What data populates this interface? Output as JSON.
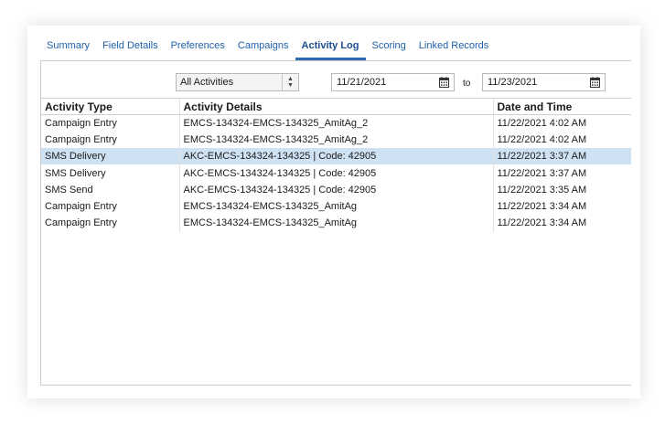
{
  "tabs": [
    {
      "label": "Summary",
      "active": false
    },
    {
      "label": "Field Details",
      "active": false
    },
    {
      "label": "Preferences",
      "active": false
    },
    {
      "label": "Campaigns",
      "active": false
    },
    {
      "label": "Activity Log",
      "active": true
    },
    {
      "label": "Scoring",
      "active": false
    },
    {
      "label": "Linked Records",
      "active": false
    }
  ],
  "filter": {
    "activity_type_selected": "All Activities",
    "date_from": "11/21/2021",
    "date_to": "11/23/2021",
    "to_label": "to"
  },
  "table": {
    "columns": [
      "Activity Type",
      "Activity Details",
      "Date and Time"
    ],
    "rows": [
      {
        "type": "Campaign Entry",
        "details": "EMCS-134324-EMCS-134325_AmitAg_2",
        "datetime": "11/22/2021 4:02 AM",
        "selected": false
      },
      {
        "type": "Campaign Entry",
        "details": "EMCS-134324-EMCS-134325_AmitAg_2",
        "datetime": "11/22/2021 4:02 AM",
        "selected": false
      },
      {
        "type": "SMS Delivery",
        "details": "AKC-EMCS-134324-134325 | Code: 42905",
        "datetime": "11/22/2021 3:37 AM",
        "selected": true
      },
      {
        "type": "SMS Delivery",
        "details": "AKC-EMCS-134324-134325 | Code: 42905",
        "datetime": "11/22/2021 3:37 AM",
        "selected": false
      },
      {
        "type": "SMS Send",
        "details": "AKC-EMCS-134324-134325 | Code: 42905",
        "datetime": "11/22/2021 3:35 AM",
        "selected": false
      },
      {
        "type": "Campaign Entry",
        "details": "EMCS-134324-EMCS-134325_AmitAg",
        "datetime": "11/22/2021 3:34 AM",
        "selected": false
      },
      {
        "type": "Campaign Entry",
        "details": "EMCS-134324-EMCS-134325_AmitAg",
        "datetime": "11/22/2021 3:34 AM",
        "selected": false
      }
    ]
  },
  "colors": {
    "tab_link": "#1f5fa8",
    "tab_active_underline": "#2b6cb5",
    "selected_row": "#cfe2f3"
  },
  "icons": {
    "select_spinner": "up-down-arrows-icon",
    "date_picker": "calendar-icon"
  }
}
